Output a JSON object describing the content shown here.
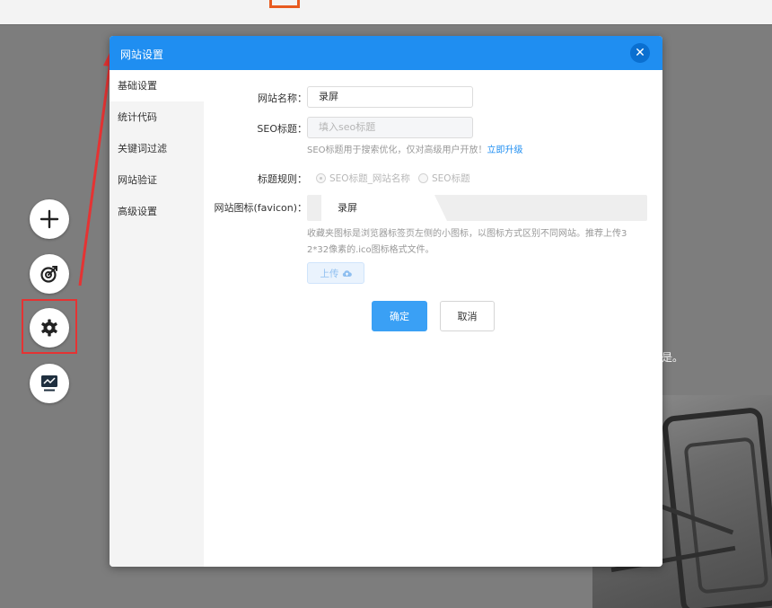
{
  "dialog": {
    "title": "网站设置",
    "close_label": "✕",
    "menu": [
      "基础设置",
      "统计代码",
      "关键词过滤",
      "网站验证",
      "高级设置"
    ],
    "fields": {
      "site_name_label": "网站名称：",
      "site_name_value": "录屏",
      "seo_title_label": "SEO标题：",
      "seo_title_placeholder": "填入seo标题",
      "seo_hint": "SEO标题用于搜索优化，仅对高级用户开放！",
      "seo_hint_link": "立即升级",
      "title_rule_label": "标题规则：",
      "title_rule_options": [
        "SEO标题_网站名称",
        "SEO标题"
      ],
      "favicon_label": "网站图标(favicon)：",
      "favicon_tab": "录屏",
      "favicon_hint_line1": "收藏夹图标是浏览器标签页左侧的小图标，以图标方式区别不同网站。推荐上传3",
      "favicon_hint_line2": "2*32像素的.ico图标格式文件。",
      "upload_label": "上传"
    },
    "buttons": {
      "confirm": "确定",
      "cancel": "取消"
    }
  },
  "sidebar_tools": [
    "add-icon",
    "target-icon",
    "gear-icon",
    "monitor-icon"
  ],
  "background": {
    "fragment_text": "是。"
  },
  "colors": {
    "accent": "#1f8ef1",
    "primary_button": "#3aa0f5",
    "highlight": "#e53333"
  }
}
